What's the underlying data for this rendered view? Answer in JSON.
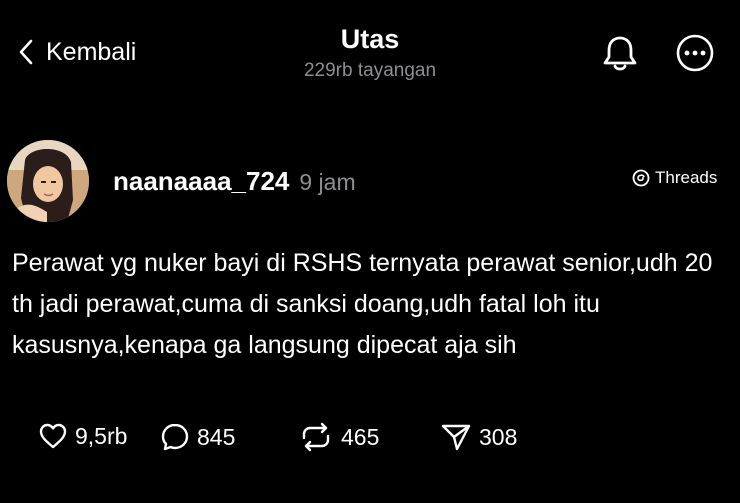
{
  "header": {
    "back_label": "Kembali",
    "title": "Utas",
    "views": "229rb tayangan"
  },
  "post": {
    "username": "naanaaaa_724",
    "time": "9 jam",
    "source_badge": "Threads",
    "text": "Perawat yg nuker bayi di RSHS ternyata perawat senior,udh 20 th jadi perawat,cuma di sanksi doang,udh fatal loh itu kasusnya,kenapa ga langsung dipecat aja sih",
    "stats": {
      "likes": "9,5rb",
      "replies": "845",
      "reposts": "465",
      "shares": "308"
    }
  }
}
